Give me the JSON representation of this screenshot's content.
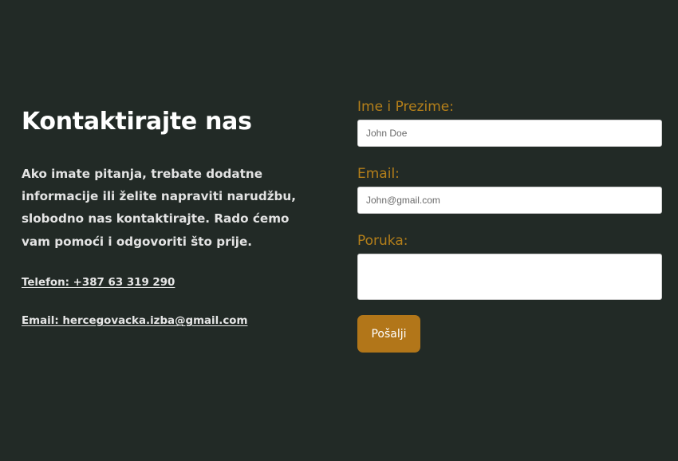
{
  "contact": {
    "title": "Kontaktirajte nas",
    "description": "Ako imate pitanja, trebate dodatne informacije ili želite napraviti narudžbu, slobodno nas kontaktirajte. Rado ćemo vam pomoći i odgovoriti što prije.",
    "phone_link": "Telefon: +387 63 319 290",
    "email_link": "Email: hercegovacka.izba@gmail.com"
  },
  "form": {
    "name_label": "Ime i Prezime:",
    "name_placeholder": "John Doe",
    "email_label": "Email:",
    "email_placeholder": "John@gmail.com",
    "message_label": "Poruka:",
    "message_placeholder": "",
    "submit_label": "Pošalji"
  },
  "colors": {
    "background": "#222a26",
    "accent": "#b27619",
    "label": "#b47f1a",
    "text": "#ffffff"
  }
}
